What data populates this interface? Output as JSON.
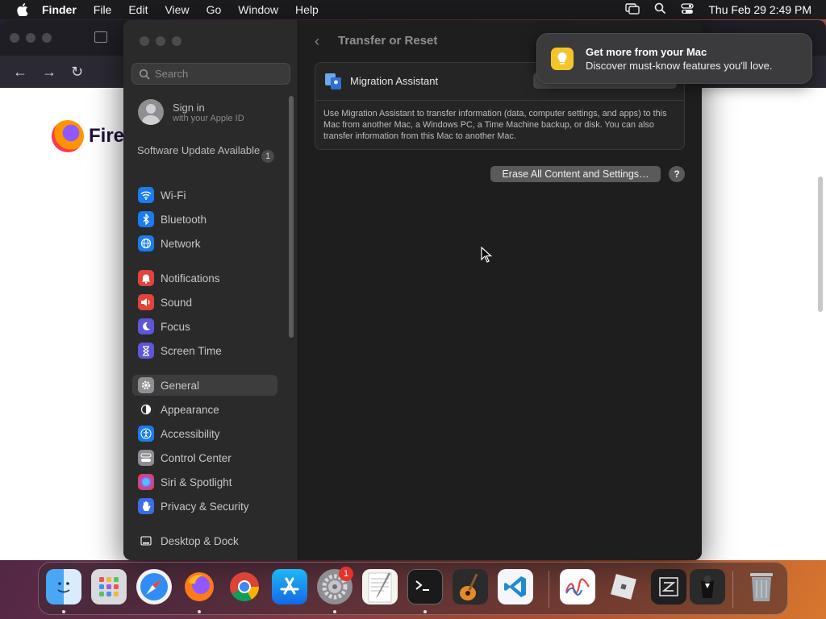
{
  "menubar": {
    "app": "Finder",
    "items": [
      "File",
      "Edit",
      "View",
      "Go",
      "Window",
      "Help"
    ],
    "clock": "Thu Feb 29  2:49 PM"
  },
  "firefox": {
    "brand_word": "Firef"
  },
  "settings": {
    "search_placeholder": "Search",
    "signin_title": "Sign in",
    "signin_subtitle": "with your Apple ID",
    "software_update": "Software Update Available",
    "software_update_badge": "1",
    "sidebar": [
      {
        "label": "Wi-Fi",
        "icon": "wifi-icon",
        "color": "#1a7cf0"
      },
      {
        "label": "Bluetooth",
        "icon": "bluetooth-icon",
        "color": "#1a7cf0"
      },
      {
        "label": "Network",
        "icon": "globe-icon",
        "color": "#1a7cf0"
      },
      {
        "label": "Notifications",
        "icon": "bell-icon",
        "color": "#e0443c"
      },
      {
        "label": "Sound",
        "icon": "speaker-icon",
        "color": "#e0443c"
      },
      {
        "label": "Focus",
        "icon": "moon-icon",
        "color": "#5e55d8"
      },
      {
        "label": "Screen Time",
        "icon": "hourglass-icon",
        "color": "#5e55d8"
      },
      {
        "label": "General",
        "icon": "gear-icon",
        "color": "#8e8e93"
      },
      {
        "label": "Appearance",
        "icon": "appearance-icon",
        "color": "#2c2c2e"
      },
      {
        "label": "Accessibility",
        "icon": "accessibility-icon",
        "color": "#1a7cf0"
      },
      {
        "label": "Control Center",
        "icon": "control-center-icon",
        "color": "#8e8e93"
      },
      {
        "label": "Siri & Spotlight",
        "icon": "siri-icon",
        "color": "#b04ad8"
      },
      {
        "label": "Privacy & Security",
        "icon": "hand-icon",
        "color": "#3a6ee8"
      },
      {
        "label": "Desktop & Dock",
        "icon": "dock-icon",
        "color": "#2c2c2e"
      }
    ],
    "selected": "General",
    "page_title": "Transfer or Reset",
    "migration_title": "Migration Assistant",
    "migration_desc": "Use Migration Assistant to transfer information (data, computer settings, and apps) to this Mac from another Mac, a Windows PC, a Time Machine backup, or disk. You can also transfer information from this Mac to another Mac.",
    "erase_button": "Erase All Content and Settings…",
    "help_button": "?"
  },
  "notification": {
    "title": "Get more from your Mac",
    "body": "Discover must-know features you'll love."
  },
  "dock": {
    "settings_badge": "1",
    "apps": [
      "Finder",
      "Launchpad",
      "Safari",
      "Firefox",
      "Chrome",
      "App Store",
      "System Settings",
      "TextEdit",
      "Terminal",
      "GarageBand",
      "Visual Studio Code",
      "Freeform",
      "Roblox",
      "Zed",
      "Alfred",
      "Trash"
    ]
  }
}
